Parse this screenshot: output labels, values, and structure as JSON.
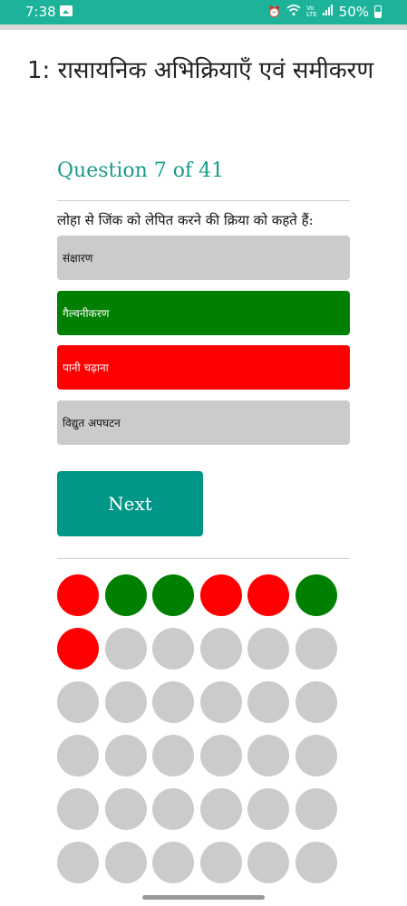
{
  "status_bar": {
    "time": "7:38",
    "battery": "50%",
    "icons": [
      "image-icon",
      "alarm-icon",
      "wifi-icon",
      "volte-icon",
      "signal-icon",
      "battery-icon"
    ]
  },
  "page": {
    "title": "1: रासायनिक अभिक्रियाएँ एवं समीकरण"
  },
  "quiz": {
    "question_label": "Question 7 of 41",
    "current": 7,
    "total": 41,
    "question": "लोहा से जिंक को लेपित करने की क्रिया को कहते हैं:",
    "options": [
      {
        "label": "संक्षारण",
        "state": "neutral",
        "color": "#cbcbcd",
        "text_color": "#111111"
      },
      {
        "label": "गैल्वनीकरण",
        "state": "correct",
        "color": "#008000",
        "text_color": "#ffffff"
      },
      {
        "label": "पानी चढ़ाना",
        "state": "wrong",
        "color": "#ff0000",
        "text_color": "#ffffff"
      },
      {
        "label": "विद्युत अपघटन",
        "state": "neutral",
        "color": "#cbcbcd",
        "text_color": "#111111"
      }
    ],
    "next_label": "Next",
    "progress": [
      "wrong",
      "correct",
      "correct",
      "wrong",
      "wrong",
      "correct",
      "wrong",
      "unanswered",
      "unanswered",
      "unanswered",
      "unanswered",
      "unanswered",
      "unanswered",
      "unanswered",
      "unanswered",
      "unanswered",
      "unanswered",
      "unanswered",
      "unanswered",
      "unanswered",
      "unanswered",
      "unanswered",
      "unanswered",
      "unanswered",
      "unanswered",
      "unanswered",
      "unanswered",
      "unanswered",
      "unanswered",
      "unanswered",
      "unanswered",
      "unanswered",
      "unanswered",
      "unanswered",
      "unanswered",
      "unanswered"
    ]
  },
  "colors": {
    "accent": "#009688",
    "header": "#1a9a8a",
    "status_bar": "#1db39a",
    "correct": "#008000",
    "wrong": "#ff0000",
    "unanswered": "#cbcbcd"
  }
}
